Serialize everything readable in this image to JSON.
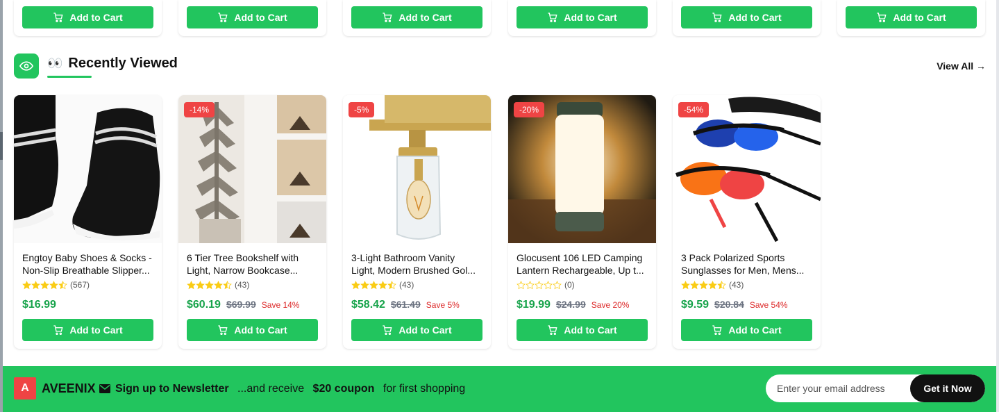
{
  "top_row": {
    "cart_label": "Add to Cart"
  },
  "section": {
    "title": "Recently Viewed",
    "eyes": "👀",
    "view_all": "View All →"
  },
  "products": [
    {
      "name_line1": "Engtoy Baby Shoes & Socks -",
      "name_line2": "Non-Slip Breathable Slipper...",
      "rating": 4.5,
      "reviews": "(567)",
      "price": "$16.99",
      "old_price": "",
      "save": "",
      "discount": "",
      "cart_label": "Add to Cart"
    },
    {
      "name_line1": "6 Tier Tree Bookshelf with",
      "name_line2": "Light, Narrow Bookcase...",
      "rating": 4.5,
      "reviews": "(43)",
      "price": "$60.19",
      "old_price": "$69.99",
      "save": "Save 14%",
      "discount": "-14%",
      "cart_label": "Add to Cart"
    },
    {
      "name_line1": "3-Light Bathroom Vanity",
      "name_line2": "Light, Modern Brushed Gol...",
      "rating": 4.5,
      "reviews": "(43)",
      "price": "$58.42",
      "old_price": "$61.49",
      "save": "Save 5%",
      "discount": "-5%",
      "cart_label": "Add to Cart"
    },
    {
      "name_line1": "Glocusent 106 LED Camping",
      "name_line2": "Lantern Rechargeable, Up t...",
      "rating": 0,
      "reviews": "(0)",
      "price": "$19.99",
      "old_price": "$24.99",
      "save": "Save 20%",
      "discount": "-20%",
      "cart_label": "Add to Cart"
    },
    {
      "name_line1": "3 Pack Polarized Sports",
      "name_line2": "Sunglasses for Men, Mens...",
      "rating": 4.5,
      "reviews": "(43)",
      "price": "$9.59",
      "old_price": "$20.84",
      "save": "Save 54%",
      "discount": "-54%",
      "cart_label": "Add to Cart"
    }
  ],
  "newsletter": {
    "logo_letter": "A",
    "brand": "AVEENIX",
    "signup": "Sign up to Newsletter",
    "receive": "...and receive",
    "coupon": "$20 coupon",
    "first": "for first shopping",
    "placeholder": "Enter your email address",
    "button": "Get it Now"
  },
  "colors": {
    "accent": "#22c55e",
    "sale": "#ef4444",
    "price": "#16a34a",
    "star": "#facc15"
  }
}
